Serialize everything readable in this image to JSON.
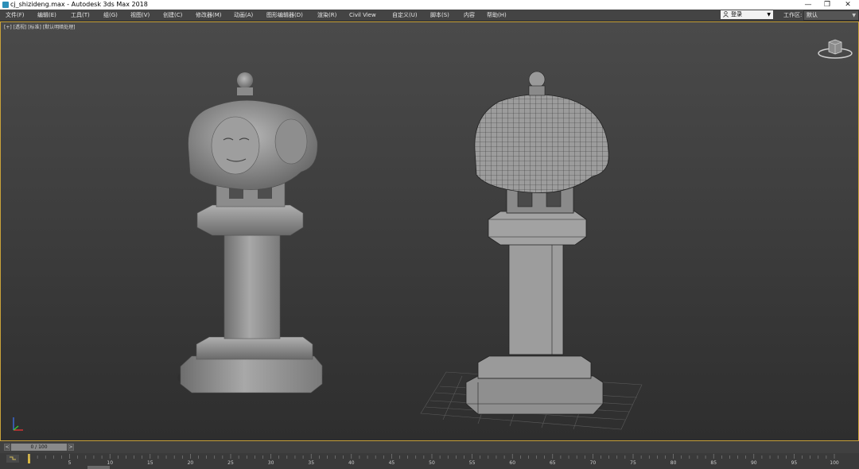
{
  "window": {
    "title": "cj_shizideng.max - Autodesk 3ds Max 2018",
    "minimize": "—",
    "restore": "❐",
    "close": "✕"
  },
  "menus": [
    "文件(F)",
    "编辑(E)",
    "工具(T)",
    "组(G)",
    "视图(V)",
    "创建(C)",
    "修改器(M)",
    "动画(A)",
    "图形编辑器(D)",
    "渲染(R)",
    "Civil View",
    "自定义(U)",
    "脚本(S)",
    "内容",
    "帮助(H)"
  ],
  "account": {
    "label": "登录",
    "icon": "user-icon"
  },
  "workspace": {
    "label": "工作区:",
    "value": "默认"
  },
  "viewport": {
    "label": "[+] [透视] [标准] [默认明暗处理]",
    "border_color": "#c9a23a",
    "icons": [
      "viewcube-icon",
      "axis-tripod-icon"
    ]
  },
  "time_slider": {
    "text": "0 / 100",
    "prev": "<",
    "next": ">"
  },
  "track_bar": {
    "ticks": [
      "5",
      "10",
      "15",
      "20",
      "25",
      "30",
      "35",
      "40",
      "45",
      "50",
      "55",
      "60",
      "65",
      "70",
      "75",
      "80",
      "85",
      "90",
      "95",
      "100"
    ],
    "key_icon": "key-icon"
  },
  "colors": {
    "menubar": "#444444",
    "viewport_bg": "#3e3e3e",
    "active_border": "#c9a23a",
    "model": "#9a9a9a"
  }
}
